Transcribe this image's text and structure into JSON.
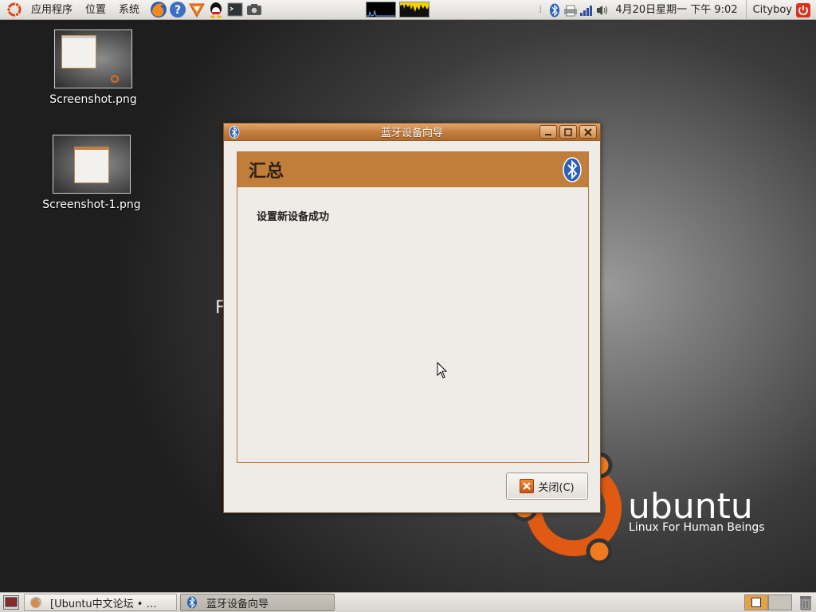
{
  "top_panel": {
    "menus": [
      "应用程序",
      "位置",
      "系统"
    ],
    "launchers": [
      "firefox-icon",
      "help-icon",
      "vlc-icon",
      "qq-icon",
      "terminal-icon",
      "screenshot-icon"
    ],
    "clock": "4月20日星期一 下午 9:02",
    "user": "Cityboy",
    "tray_icons": [
      "bluetooth-icon",
      "printer-icon",
      "network-signal-icon",
      "volume-icon"
    ]
  },
  "desktop": {
    "icons": [
      {
        "label": "Screenshot.png"
      },
      {
        "label": "Screenshot-1.png"
      }
    ],
    "stray_text": "F"
  },
  "wallpaper": {
    "word": "ubuntu",
    "tagline": "Linux For Human Beings"
  },
  "dialog": {
    "title": "蓝牙设备向导",
    "page_title": "汇总",
    "message": "设置新设备成功",
    "close_label": "关闭(C)"
  },
  "taskbar": {
    "tasks": [
      {
        "label": "[Ubuntu中文论坛 • …",
        "active": false
      },
      {
        "label": "蓝牙设备向导",
        "active": true
      }
    ]
  },
  "colors": {
    "accent": "#c17d3a",
    "title_gradient_top": "#e4a56a",
    "dialog_bg": "#efebe7",
    "workspace_active": "#e3a24a"
  }
}
